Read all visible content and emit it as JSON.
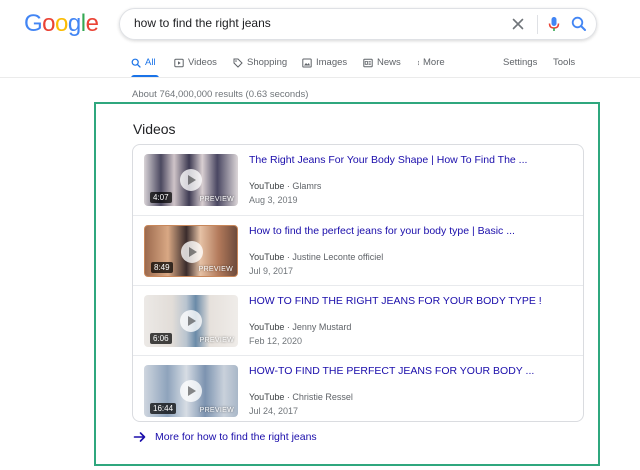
{
  "logo": {
    "g1": "G",
    "g2": "o",
    "g3": "o",
    "g4": "g",
    "g5": "l",
    "g6": "e"
  },
  "search": {
    "value": "how to find the right jeans"
  },
  "tabs": [
    {
      "label": "All",
      "icon": "search-icon",
      "active": true
    },
    {
      "label": "Videos",
      "icon": "play-icon"
    },
    {
      "label": "Shopping",
      "icon": "tag-icon"
    },
    {
      "label": "Images",
      "icon": "image-icon"
    },
    {
      "label": "News",
      "icon": "newspaper-icon"
    },
    {
      "label": "More",
      "icon": "dots-vertical-icon"
    },
    {
      "label": "Settings"
    },
    {
      "label": "Tools"
    }
  ],
  "result_stats": "About 764,000,000 results (0.63 seconds)",
  "videos": {
    "heading": "Videos",
    "items": [
      {
        "title": "The Right Jeans For Your Body Shape | How To Find The ...",
        "source": "YouTube",
        "channel": "Glamrs",
        "date": "Aug 3, 2019",
        "duration": "4:07",
        "preview": "PREVIEW"
      },
      {
        "title": "How to find the perfect jeans for your body type | Basic ...",
        "source": "YouTube",
        "channel": "Justine Leconte officiel",
        "date": "Jul 9, 2017",
        "duration": "8:49",
        "preview": "PREVIEW"
      },
      {
        "title": "HOW TO FIND THE RIGHT JEANS FOR YOUR BODY TYPE !",
        "source": "YouTube",
        "channel": "Jenny Mustard",
        "date": "Feb 12, 2020",
        "duration": "6:06",
        "preview": "PREVIEW"
      },
      {
        "title": "HOW-TO FIND THE PERFECT JEANS FOR YOUR BODY ...",
        "source": "YouTube",
        "channel": "Christie Ressel",
        "date": "Jul 24, 2017",
        "duration": "16:44",
        "preview": "PREVIEW"
      }
    ],
    "more_link": "More for how to find the right jeans"
  },
  "colors": {
    "link": "#1a0dab",
    "accent": "#1a73e8",
    "highlight": "#2fa77e"
  }
}
